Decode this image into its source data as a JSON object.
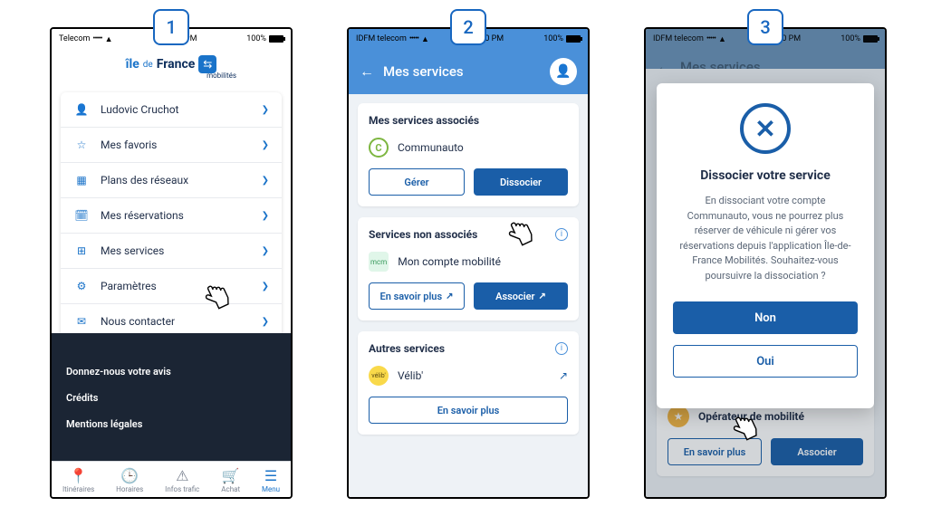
{
  "status_bar": {
    "carrier_s1": "Telecom",
    "carrier_s23": "IDFM telecom",
    "dots": "•••••",
    "wifi_icon": "wifi",
    "time": "12:00 PM",
    "battery_pct": "100%"
  },
  "screen1": {
    "step": "1",
    "brand": {
      "ile": "île",
      "de": "de",
      "france": "France",
      "sub": "mobilités",
      "logo_glyph": "⇆"
    },
    "menu": [
      {
        "icon": "👤",
        "label": "Ludovic Cruchot"
      },
      {
        "icon": "☆",
        "label": "Mes favoris"
      },
      {
        "icon": "▦",
        "label": "Plans des réseaux"
      },
      {
        "icon": "🗓",
        "label": "Mes réservations"
      },
      {
        "icon": "⊞",
        "label": "Mes services"
      },
      {
        "icon": "⚙",
        "label": "Paramètres"
      },
      {
        "icon": "✉",
        "label": "Nous contacter"
      }
    ],
    "dark_links": [
      "Donnez-nous votre avis",
      "Crédits",
      "Mentions légales"
    ],
    "bottom_nav": [
      {
        "icon": "📍",
        "label": "Itinéraires"
      },
      {
        "icon": "🕒",
        "label": "Horaires"
      },
      {
        "icon": "⚠",
        "label": "Infos trafic"
      },
      {
        "icon": "🛒",
        "label": "Achat"
      },
      {
        "icon": "☰",
        "label": "Menu",
        "active": true
      }
    ]
  },
  "screen2": {
    "step": "2",
    "header_title": "Mes services",
    "section_associated": {
      "title": "Mes services associés",
      "service_name": "Communauto",
      "service_glyph": "C",
      "btn_manage": "Gérer",
      "btn_dissociate": "Dissocier"
    },
    "section_unassociated": {
      "title": "Services non associés",
      "service_name": "Mon compte mobilité",
      "service_glyph": "mcm",
      "btn_more": "En savoir plus",
      "btn_assoc": "Associer"
    },
    "section_other": {
      "title": "Autres services",
      "service_name": "Vélib'",
      "service_glyph": "vélib'",
      "btn_more": "En savoir plus"
    }
  },
  "screen3": {
    "step": "3",
    "header_title": "Mes services",
    "dialog": {
      "heading": "Dissocier votre service",
      "body": "En dissociant votre compte Communauto, vous ne pourrez plus réserver de véhicule ni gérer vos réservations depuis l'application Île-de-France Mobilités. Souhaitez-vous poursuivre la dissociation ?",
      "btn_no": "Non",
      "btn_yes": "Oui"
    },
    "bg_card": {
      "title": "Opérateur de mobilité",
      "btn_more": "En savoir plus",
      "btn_assoc": "Associer"
    }
  }
}
